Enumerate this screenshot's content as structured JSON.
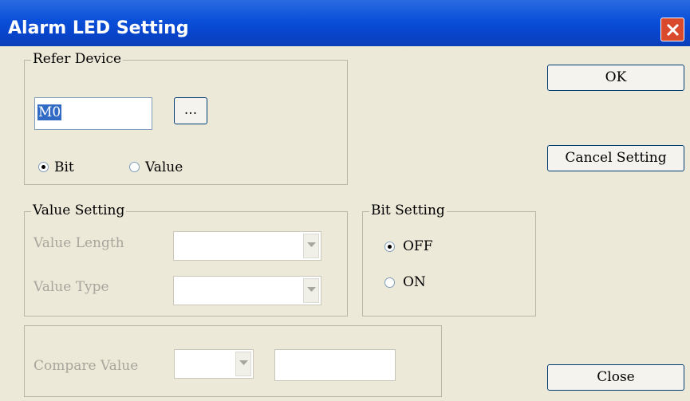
{
  "window": {
    "title": "Alarm LED Setting"
  },
  "refer_device": {
    "legend": "Refer Device",
    "device_value": "M0",
    "browse_label": "...",
    "options": [
      {
        "label": "Bit",
        "selected": true
      },
      {
        "label": "Value",
        "selected": false
      }
    ]
  },
  "value_setting": {
    "legend": "Value Setting",
    "length_label": "Value Length",
    "type_label": "Value Type"
  },
  "bit_setting": {
    "legend": "Bit Setting",
    "options": [
      {
        "label": "OFF",
        "selected": true
      },
      {
        "label": "ON",
        "selected": false
      }
    ]
  },
  "compare": {
    "label": "Compare Value"
  },
  "buttons": {
    "ok": "OK",
    "cancel": "Cancel Setting",
    "close": "Close"
  },
  "colors": {
    "titlebar": "#0a4fd8",
    "dialog_bg": "#ece9d8",
    "close_button": "#d9492c",
    "selection": "#316ac5"
  }
}
